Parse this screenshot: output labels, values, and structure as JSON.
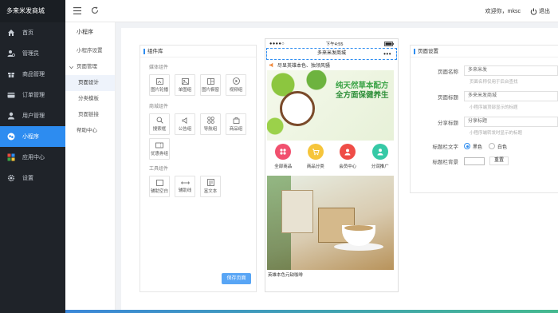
{
  "app": {
    "brand": "多来米发商城"
  },
  "topbar": {
    "greeting": "欢迎你，mksc",
    "logout": "退出"
  },
  "sidebar": {
    "items": [
      {
        "label": "首页",
        "icon": "home-icon"
      },
      {
        "label": "管理员",
        "icon": "user-gear-icon"
      },
      {
        "label": "商品管理",
        "icon": "gift-icon"
      },
      {
        "label": "订单管理",
        "icon": "card-icon"
      },
      {
        "label": "用户管理",
        "icon": "user-icon"
      },
      {
        "label": "小程序",
        "icon": "wechat-icon",
        "active": true
      },
      {
        "label": "应用中心",
        "icon": "apps-icon"
      },
      {
        "label": "设置",
        "icon": "gear-icon"
      }
    ]
  },
  "subnav": {
    "title": "小程序",
    "items": [
      {
        "label": "小程序设置"
      },
      {
        "label": "页面管理",
        "group": true
      },
      {
        "label": "页面设计",
        "active": true
      },
      {
        "label": "分类模板"
      },
      {
        "label": "页面链接"
      },
      {
        "label": "帮助中心"
      }
    ]
  },
  "component_panel": {
    "title": "组件库",
    "sections": [
      {
        "title": "媒体组件",
        "items": [
          "图片轮播",
          "单图组",
          "图片橱窗",
          "视频组"
        ]
      },
      {
        "title": "商城组件",
        "items": [
          "搜索框",
          "公告组",
          "导航组",
          "商品组",
          "优惠券组"
        ]
      },
      {
        "title": "工具组件",
        "items": [
          "辅助空白",
          "辅助线",
          "富文本"
        ]
      }
    ],
    "save_label": "保存页面"
  },
  "phone": {
    "time": "下午4:55",
    "title": "多来米发商城",
    "menu": "•••",
    "notice": "尽显英雄本色、独领风骚",
    "banner_line1": "纯天然草本配方",
    "banner_line2": "全方面保健养生",
    "nav": [
      {
        "label": "全部商品",
        "color": "#f1506e"
      },
      {
        "label": "商品分类",
        "color": "#f6c53b"
      },
      {
        "label": "会员中心",
        "color": "#ef4d47"
      },
      {
        "label": "分润推广",
        "color": "#36c9a6"
      }
    ],
    "product_caption": "英雄本色元缺咖啡"
  },
  "settings": {
    "title": "页面设置",
    "fields": [
      {
        "label": "页面名称",
        "value": "多来米发",
        "hint": "页面名称仅用于后台查找"
      },
      {
        "label": "页面标题",
        "value": "多来米发商城",
        "hint": "小程序端顶部显示的标题"
      },
      {
        "label": "分享标题",
        "value": "分享标题",
        "hint": "小程序端转发时显示的标题"
      }
    ],
    "title_text_label": "标题栏文字",
    "title_text_options": [
      "黑色",
      "白色"
    ],
    "title_bg_label": "标题栏背景",
    "reset_label": "重置"
  },
  "colors": {
    "primary": "#2d8cf0",
    "sidebar": "#1f2329",
    "green": "#3aa345"
  }
}
